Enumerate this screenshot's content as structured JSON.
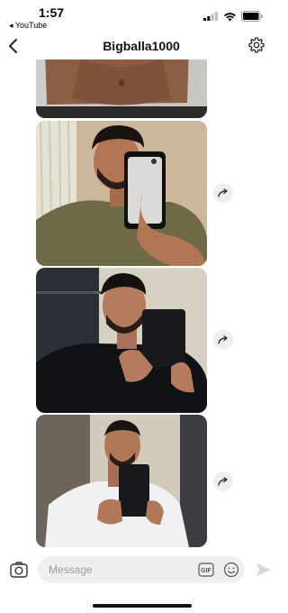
{
  "status_bar": {
    "time": "1:57",
    "back_app": "◂ YouTube"
  },
  "header": {
    "title": "Bigballa1000"
  },
  "messages": [
    {
      "type": "photo",
      "description": "shirtless torso, partial"
    },
    {
      "type": "photo",
      "description": "mirror selfie, olive t-shirt, white phone"
    },
    {
      "type": "photo",
      "description": "mirror selfie, black sweater, black phone"
    },
    {
      "type": "photo",
      "description": "mirror selfie, white t-shirt, black phone"
    }
  ],
  "composer": {
    "placeholder": "Message",
    "gif_label": "GIF"
  },
  "colors": {
    "background": "#ffffff",
    "input_background": "#efefef",
    "share_button": "#eeeeee"
  }
}
